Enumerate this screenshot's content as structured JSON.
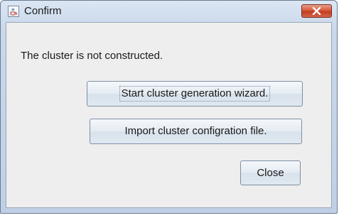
{
  "window": {
    "title": "Confirm",
    "title_icon": "java-coffee-cup-icon",
    "close_icon": "close-icon"
  },
  "dialog": {
    "message": "The cluster is not constructed.",
    "buttons": {
      "start_wizard": "Start cluster generation wizard.",
      "import_file": "Import cluster configration file.",
      "close": "Close"
    }
  },
  "colors": {
    "close_button": "#d6553a",
    "client_background": "#eeeeee",
    "frame": "#c9d8eb"
  }
}
